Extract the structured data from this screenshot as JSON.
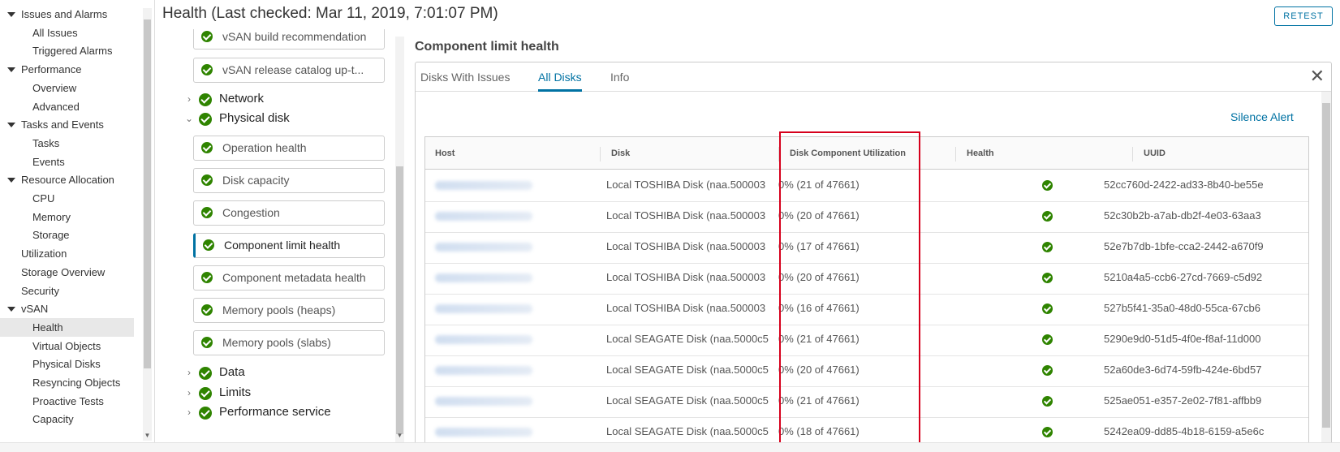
{
  "nav": {
    "items": [
      {
        "label": "Issues and Alarms",
        "kind": "group"
      },
      {
        "label": "All Issues",
        "kind": "child"
      },
      {
        "label": "Triggered Alarms",
        "kind": "child"
      },
      {
        "label": "Performance",
        "kind": "group"
      },
      {
        "label": "Overview",
        "kind": "child"
      },
      {
        "label": "Advanced",
        "kind": "child"
      },
      {
        "label": "Tasks and Events",
        "kind": "group"
      },
      {
        "label": "Tasks",
        "kind": "child"
      },
      {
        "label": "Events",
        "kind": "child"
      },
      {
        "label": "Resource Allocation",
        "kind": "group"
      },
      {
        "label": "CPU",
        "kind": "child"
      },
      {
        "label": "Memory",
        "kind": "child"
      },
      {
        "label": "Storage",
        "kind": "child"
      },
      {
        "label": "Utilization",
        "kind": "plain"
      },
      {
        "label": "Storage Overview",
        "kind": "plain"
      },
      {
        "label": "Security",
        "kind": "plain"
      },
      {
        "label": "vSAN",
        "kind": "group"
      },
      {
        "label": "Health",
        "kind": "child",
        "active": true
      },
      {
        "label": "Virtual Objects",
        "kind": "child"
      },
      {
        "label": "Physical Disks",
        "kind": "child"
      },
      {
        "label": "Resyncing Objects",
        "kind": "child"
      },
      {
        "label": "Proactive Tests",
        "kind": "child"
      },
      {
        "label": "Capacity",
        "kind": "child"
      }
    ]
  },
  "header": {
    "title": "Health (Last checked: Mar 11, 2019, 7:01:07 PM)",
    "retest_label": "RETEST"
  },
  "tests": {
    "top_boxes": [
      "vSAN build recommendation",
      "vSAN release catalog up-t..."
    ],
    "network_label": "Network",
    "physical_disk_label": "Physical disk",
    "physical_disk_items": [
      {
        "label": "Operation health"
      },
      {
        "label": "Disk capacity"
      },
      {
        "label": "Congestion"
      },
      {
        "label": "Component limit health",
        "selected": true
      },
      {
        "label": "Component metadata health"
      },
      {
        "label": "Memory pools (heaps)"
      },
      {
        "label": "Memory pools (slabs)"
      }
    ],
    "groups_after": [
      "Data",
      "Limits",
      "Performance service"
    ]
  },
  "detail": {
    "title": "Component limit health",
    "tabs": [
      "Disks With Issues",
      "All Disks",
      "Info"
    ],
    "active_tab": "All Disks",
    "silence_label": "Silence Alert",
    "columns": [
      "Host",
      "Disk",
      "Disk Component Utilization",
      "Health",
      "UUID"
    ],
    "rows": [
      {
        "disk": "Local TOSHIBA Disk (naa.500003",
        "util": "0% (21 of 47661)",
        "uuid": "52cc760d-2422-ad33-8b40-be55e"
      },
      {
        "disk": "Local TOSHIBA Disk (naa.500003",
        "util": "0% (20 of 47661)",
        "uuid": "52c30b2b-a7ab-db2f-4e03-63aa3"
      },
      {
        "disk": "Local TOSHIBA Disk (naa.500003",
        "util": "0% (17 of 47661)",
        "uuid": "52e7b7db-1bfe-cca2-2442-a670f9"
      },
      {
        "disk": "Local TOSHIBA Disk (naa.500003",
        "util": "0% (20 of 47661)",
        "uuid": "5210a4a5-ccb6-27cd-7669-c5d92"
      },
      {
        "disk": "Local TOSHIBA Disk (naa.500003",
        "util": "0% (16 of 47661)",
        "uuid": "527b5f41-35a0-48d0-55ca-67cb6"
      },
      {
        "disk": "Local SEAGATE Disk (naa.5000c5",
        "util": "0% (21 of 47661)",
        "uuid": "5290e9d0-51d5-4f0e-f8af-11d000"
      },
      {
        "disk": "Local SEAGATE Disk (naa.5000c5",
        "util": "0% (20 of 47661)",
        "uuid": "52a60de3-6d74-59fb-424e-6bd57"
      },
      {
        "disk": "Local SEAGATE Disk (naa.5000c5",
        "util": "0% (21 of 47661)",
        "uuid": "525ae051-e357-2e02-7f81-affbb9"
      },
      {
        "disk": "Local SEAGATE Disk (naa.5000c5",
        "util": "0% (18 of 47661)",
        "uuid": "5242ea09-dd85-4b18-6159-a5e6c"
      }
    ]
  }
}
